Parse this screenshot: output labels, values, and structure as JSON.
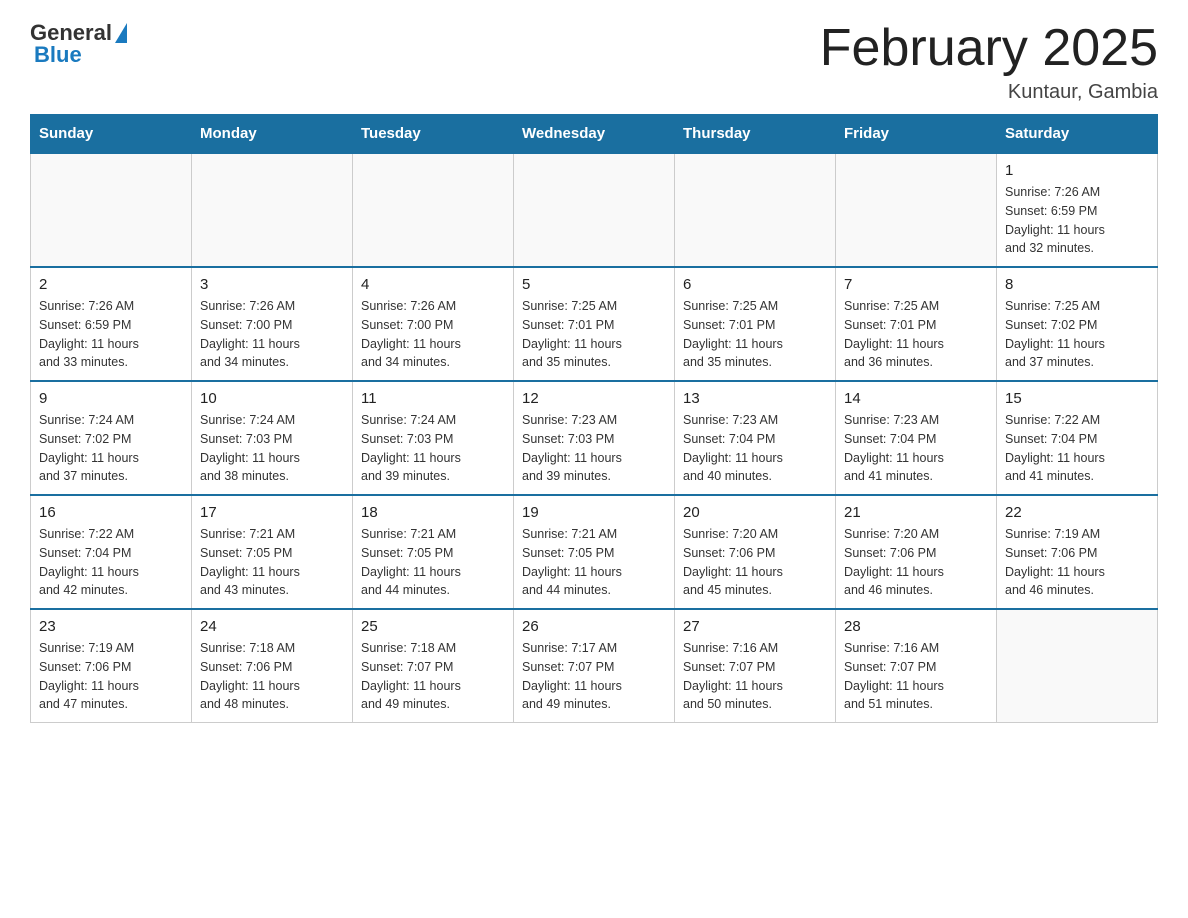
{
  "header": {
    "logo": {
      "general": "General",
      "blue": "Blue"
    },
    "title": "February 2025",
    "location": "Kuntaur, Gambia"
  },
  "days_of_week": [
    "Sunday",
    "Monday",
    "Tuesday",
    "Wednesday",
    "Thursday",
    "Friday",
    "Saturday"
  ],
  "weeks": [
    [
      {
        "day": "",
        "info": ""
      },
      {
        "day": "",
        "info": ""
      },
      {
        "day": "",
        "info": ""
      },
      {
        "day": "",
        "info": ""
      },
      {
        "day": "",
        "info": ""
      },
      {
        "day": "",
        "info": ""
      },
      {
        "day": "1",
        "info": "Sunrise: 7:26 AM\nSunset: 6:59 PM\nDaylight: 11 hours\nand 32 minutes."
      }
    ],
    [
      {
        "day": "2",
        "info": "Sunrise: 7:26 AM\nSunset: 6:59 PM\nDaylight: 11 hours\nand 33 minutes."
      },
      {
        "day": "3",
        "info": "Sunrise: 7:26 AM\nSunset: 7:00 PM\nDaylight: 11 hours\nand 34 minutes."
      },
      {
        "day": "4",
        "info": "Sunrise: 7:26 AM\nSunset: 7:00 PM\nDaylight: 11 hours\nand 34 minutes."
      },
      {
        "day": "5",
        "info": "Sunrise: 7:25 AM\nSunset: 7:01 PM\nDaylight: 11 hours\nand 35 minutes."
      },
      {
        "day": "6",
        "info": "Sunrise: 7:25 AM\nSunset: 7:01 PM\nDaylight: 11 hours\nand 35 minutes."
      },
      {
        "day": "7",
        "info": "Sunrise: 7:25 AM\nSunset: 7:01 PM\nDaylight: 11 hours\nand 36 minutes."
      },
      {
        "day": "8",
        "info": "Sunrise: 7:25 AM\nSunset: 7:02 PM\nDaylight: 11 hours\nand 37 minutes."
      }
    ],
    [
      {
        "day": "9",
        "info": "Sunrise: 7:24 AM\nSunset: 7:02 PM\nDaylight: 11 hours\nand 37 minutes."
      },
      {
        "day": "10",
        "info": "Sunrise: 7:24 AM\nSunset: 7:03 PM\nDaylight: 11 hours\nand 38 minutes."
      },
      {
        "day": "11",
        "info": "Sunrise: 7:24 AM\nSunset: 7:03 PM\nDaylight: 11 hours\nand 39 minutes."
      },
      {
        "day": "12",
        "info": "Sunrise: 7:23 AM\nSunset: 7:03 PM\nDaylight: 11 hours\nand 39 minutes."
      },
      {
        "day": "13",
        "info": "Sunrise: 7:23 AM\nSunset: 7:04 PM\nDaylight: 11 hours\nand 40 minutes."
      },
      {
        "day": "14",
        "info": "Sunrise: 7:23 AM\nSunset: 7:04 PM\nDaylight: 11 hours\nand 41 minutes."
      },
      {
        "day": "15",
        "info": "Sunrise: 7:22 AM\nSunset: 7:04 PM\nDaylight: 11 hours\nand 41 minutes."
      }
    ],
    [
      {
        "day": "16",
        "info": "Sunrise: 7:22 AM\nSunset: 7:04 PM\nDaylight: 11 hours\nand 42 minutes."
      },
      {
        "day": "17",
        "info": "Sunrise: 7:21 AM\nSunset: 7:05 PM\nDaylight: 11 hours\nand 43 minutes."
      },
      {
        "day": "18",
        "info": "Sunrise: 7:21 AM\nSunset: 7:05 PM\nDaylight: 11 hours\nand 44 minutes."
      },
      {
        "day": "19",
        "info": "Sunrise: 7:21 AM\nSunset: 7:05 PM\nDaylight: 11 hours\nand 44 minutes."
      },
      {
        "day": "20",
        "info": "Sunrise: 7:20 AM\nSunset: 7:06 PM\nDaylight: 11 hours\nand 45 minutes."
      },
      {
        "day": "21",
        "info": "Sunrise: 7:20 AM\nSunset: 7:06 PM\nDaylight: 11 hours\nand 46 minutes."
      },
      {
        "day": "22",
        "info": "Sunrise: 7:19 AM\nSunset: 7:06 PM\nDaylight: 11 hours\nand 46 minutes."
      }
    ],
    [
      {
        "day": "23",
        "info": "Sunrise: 7:19 AM\nSunset: 7:06 PM\nDaylight: 11 hours\nand 47 minutes."
      },
      {
        "day": "24",
        "info": "Sunrise: 7:18 AM\nSunset: 7:06 PM\nDaylight: 11 hours\nand 48 minutes."
      },
      {
        "day": "25",
        "info": "Sunrise: 7:18 AM\nSunset: 7:07 PM\nDaylight: 11 hours\nand 49 minutes."
      },
      {
        "day": "26",
        "info": "Sunrise: 7:17 AM\nSunset: 7:07 PM\nDaylight: 11 hours\nand 49 minutes."
      },
      {
        "day": "27",
        "info": "Sunrise: 7:16 AM\nSunset: 7:07 PM\nDaylight: 11 hours\nand 50 minutes."
      },
      {
        "day": "28",
        "info": "Sunrise: 7:16 AM\nSunset: 7:07 PM\nDaylight: 11 hours\nand 51 minutes."
      },
      {
        "day": "",
        "info": ""
      }
    ]
  ]
}
